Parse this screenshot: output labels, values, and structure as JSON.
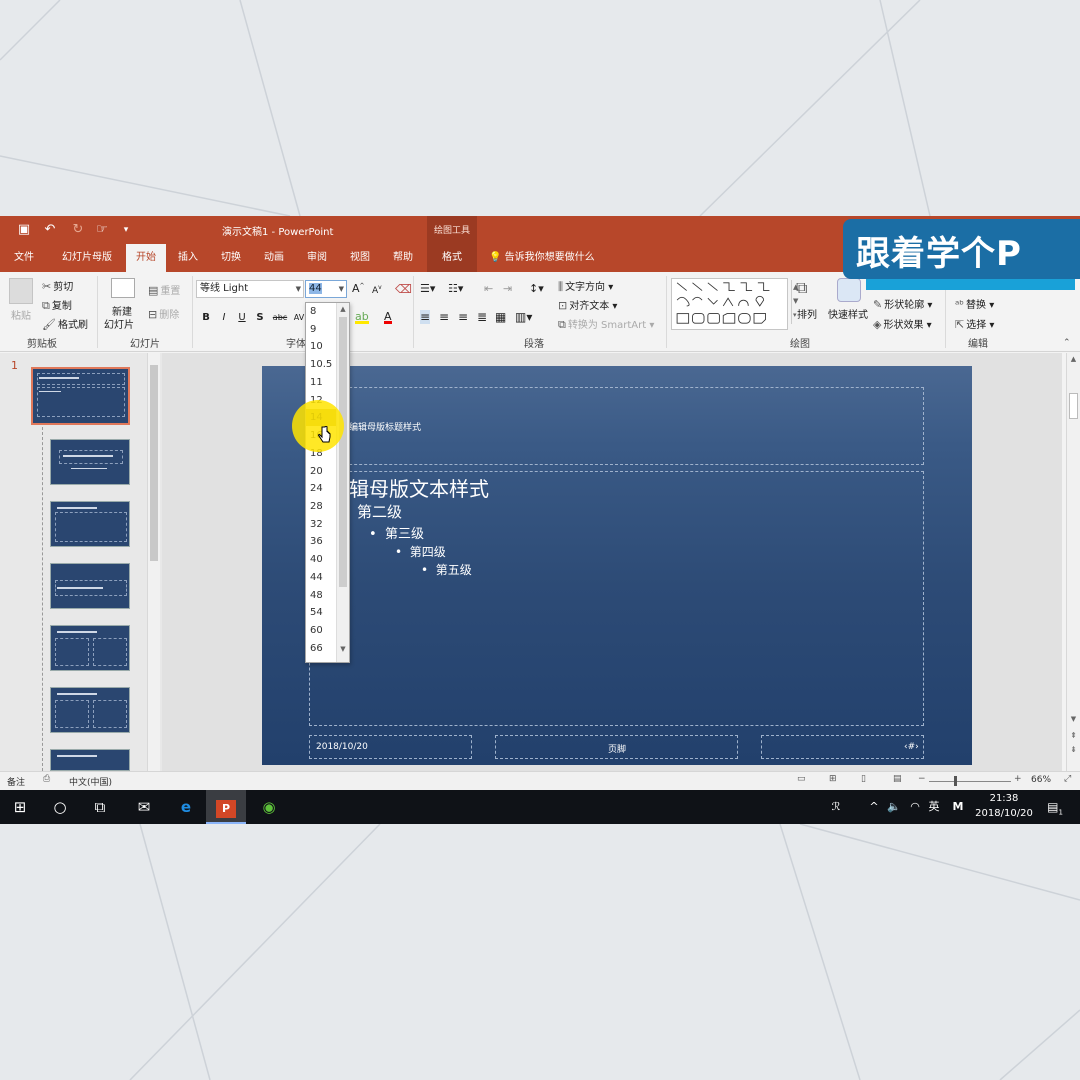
{
  "app": {
    "title": "演示文稿1  -  PowerPoint",
    "context_group": "绘图工具",
    "quick_access": [
      "save-icon",
      "undo-icon",
      "redo-icon",
      "touch-mode-icon",
      "customize-icon"
    ]
  },
  "tabs": [
    {
      "label": "文件",
      "active": false
    },
    {
      "label": "幻灯片母版",
      "active": false
    },
    {
      "label": "开始",
      "active": true
    },
    {
      "label": "插入",
      "active": false
    },
    {
      "label": "切换",
      "active": false
    },
    {
      "label": "动画",
      "active": false
    },
    {
      "label": "审阅",
      "active": false
    },
    {
      "label": "视图",
      "active": false
    },
    {
      "label": "帮助",
      "active": false
    },
    {
      "label": "格式",
      "active": false
    }
  ],
  "tell_me": "告诉我你想要做什么",
  "ribbon": {
    "clipboard": {
      "label": "剪贴板",
      "paste": "粘贴",
      "cut": "剪切",
      "copy": "复制",
      "format_painter": "格式刷"
    },
    "slides": {
      "label": "幻灯片",
      "new_slide": "新建",
      "new_slide2": "幻灯片",
      "reset": "重置",
      "delete": "删除"
    },
    "font": {
      "label": "字体",
      "font_name": "等线 Light",
      "font_size": "44",
      "bold": "B",
      "italic": "I",
      "underline": "U",
      "shadow": "S",
      "strike": "abc",
      "spacing": "AV"
    },
    "paragraph": {
      "label": "段落",
      "text_direction": "文字方向",
      "align_text": "对齐文本",
      "smartart": "转换为 SmartArt"
    },
    "drawing": {
      "label": "绘图",
      "arrange": "排列",
      "quick_styles": "快速样式",
      "shape_outline": "形状轮廓",
      "shape_effects": "形状效果"
    },
    "editing": {
      "label": "编辑",
      "replace": "替换",
      "select": "选择"
    }
  },
  "font_size_list": [
    "8",
    "9",
    "10",
    "10.5",
    "11",
    "12",
    "14",
    "16",
    "18",
    "20",
    "24",
    "28",
    "32",
    "36",
    "40",
    "44",
    "48",
    "54",
    "60",
    "66"
  ],
  "font_size_hover": "14",
  "slide": {
    "title_placeholder": "编辑母版标题样式",
    "body_level1": "辑母版文本样式",
    "body_level2": "第二级",
    "body_level3": "第三级",
    "body_level4": "第四级",
    "body_level5": "第五级",
    "date": "2018/10/20",
    "footer": "页脚",
    "slide_number": "‹#›"
  },
  "thumbnails": {
    "first_index": "1"
  },
  "status": {
    "notes": "备注",
    "language": "中文(中国)",
    "zoom": "66%"
  },
  "taskbar": {
    "time": "21:38",
    "date": "2018/10/20",
    "ime": "英",
    "notify_count": "1"
  },
  "banner": {
    "text": "跟着学个P"
  },
  "colors": {
    "accent": "#b7472a",
    "slide_bg": "#2d4b76",
    "banner": "#1b6ea5",
    "highlight": "#ffe400"
  }
}
